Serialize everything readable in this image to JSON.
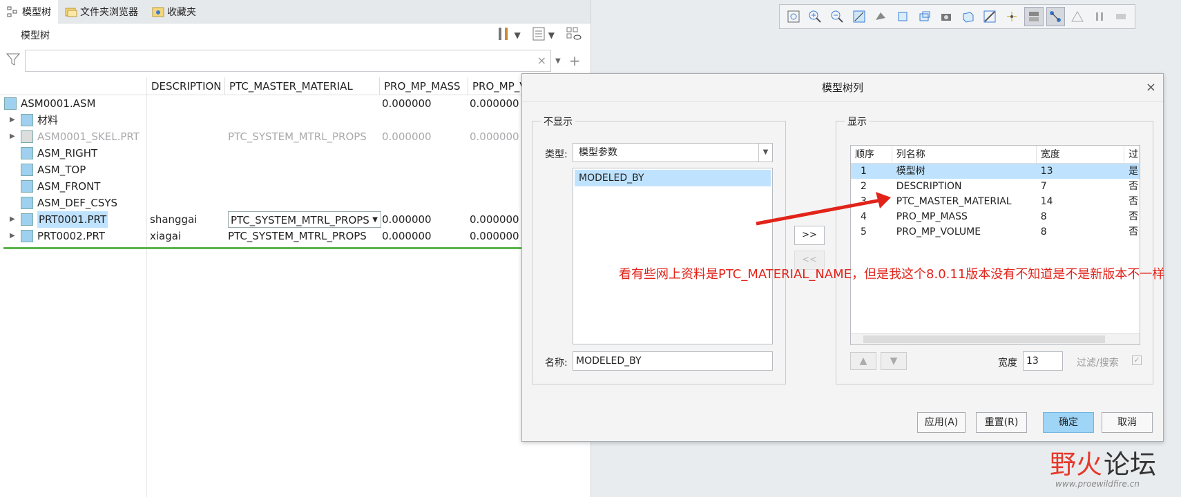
{
  "tabs": [
    {
      "label": "模型树",
      "icon": "model-tree-icon"
    },
    {
      "label": "文件夹浏览器",
      "icon": "folder-browser-icon"
    },
    {
      "label": "收藏夹",
      "icon": "favorites-icon"
    }
  ],
  "tree_header": "模型树",
  "filter": {
    "value": "",
    "clear": "×"
  },
  "columns": [
    "DESCRIPTION",
    "PTC_MASTER_MATERIAL",
    "PRO_MP_MASS",
    "PRO_MP_V"
  ],
  "rows": [
    {
      "name": "ASM0001.ASM",
      "icon": "assembly-icon",
      "desc": "",
      "mat": "",
      "mass": "0.000000",
      "vol": "0.000000",
      "expand": false,
      "gray": false,
      "indent": 0
    },
    {
      "name": "材料",
      "icon": "material-icon",
      "desc": "",
      "mat": "",
      "mass": "",
      "vol": "",
      "expand": true,
      "gray": false,
      "indent": 1
    },
    {
      "name": "ASM0001_SKEL.PRT",
      "icon": "skeleton-icon",
      "desc": "",
      "mat": "PTC_SYSTEM_MTRL_PROPS",
      "mass": "0.000000",
      "vol": "0.000000",
      "expand": true,
      "gray": true,
      "indent": 1
    },
    {
      "name": "ASM_RIGHT",
      "icon": "datum-plane-icon",
      "desc": "",
      "mat": "",
      "mass": "",
      "vol": "",
      "expand": false,
      "gray": false,
      "indent": 1
    },
    {
      "name": "ASM_TOP",
      "icon": "datum-plane-icon",
      "desc": "",
      "mat": "",
      "mass": "",
      "vol": "",
      "expand": false,
      "gray": false,
      "indent": 1
    },
    {
      "name": "ASM_FRONT",
      "icon": "datum-plane-icon",
      "desc": "",
      "mat": "",
      "mass": "",
      "vol": "",
      "expand": false,
      "gray": false,
      "indent": 1
    },
    {
      "name": "ASM_DEF_CSYS",
      "icon": "csys-icon",
      "desc": "",
      "mat": "",
      "mass": "",
      "vol": "",
      "expand": false,
      "gray": false,
      "indent": 1
    },
    {
      "name": "PRT0001.PRT",
      "icon": "part-icon",
      "desc": "shanggai",
      "mat": "PTC_SYSTEM_MTRL_PROPS",
      "mass": "0.000000",
      "vol": "0.000000",
      "expand": true,
      "gray": false,
      "indent": 1,
      "selected": true,
      "dropdown": true
    },
    {
      "name": "PRT0002.PRT",
      "icon": "part-icon",
      "desc": "xiagai",
      "mat": "PTC_SYSTEM_MTRL_PROPS",
      "mass": "0.000000",
      "vol": "0.000000",
      "expand": true,
      "gray": false,
      "indent": 1
    }
  ],
  "dialog": {
    "title": "模型树列",
    "close": "×",
    "hidden_group": "不显示",
    "type_label": "类型:",
    "type_value": "模型参数",
    "hidden_list": [
      "MODELED_BY"
    ],
    "name_label": "名称:",
    "name_value": "MODELED_BY",
    "add_btn": ">>",
    "remove_btn": "<<",
    "shown_group": "显示",
    "table_headers": [
      "顺序",
      "列名称",
      "宽度",
      "过"
    ],
    "table_rows": [
      {
        "order": "1",
        "name": "模型树",
        "width": "13",
        "filter": "是"
      },
      {
        "order": "2",
        "name": "DESCRIPTION",
        "width": "7",
        "filter": "否"
      },
      {
        "order": "3",
        "name": "PTC_MASTER_MATERIAL",
        "width": "14",
        "filter": "否"
      },
      {
        "order": "4",
        "name": "PRO_MP_MASS",
        "width": "8",
        "filter": "否"
      },
      {
        "order": "5",
        "name": "PRO_MP_VOLUME",
        "width": "8",
        "filter": "否"
      }
    ],
    "width_label": "宽度",
    "width_value": "13",
    "filter_label": "过滤/搜索",
    "apply": "应用(A)",
    "reset": "重置(R)",
    "ok": "确定",
    "cancel": "取消"
  },
  "annotation": "看有些网上资料是PTC_MATERIAL_NAME，但是我这个8.0.11版本没有不知道是不是新版本不一样",
  "watermark": {
    "text1": "野火",
    "text2": "论坛",
    "url": "www.proewildfire.cn"
  }
}
